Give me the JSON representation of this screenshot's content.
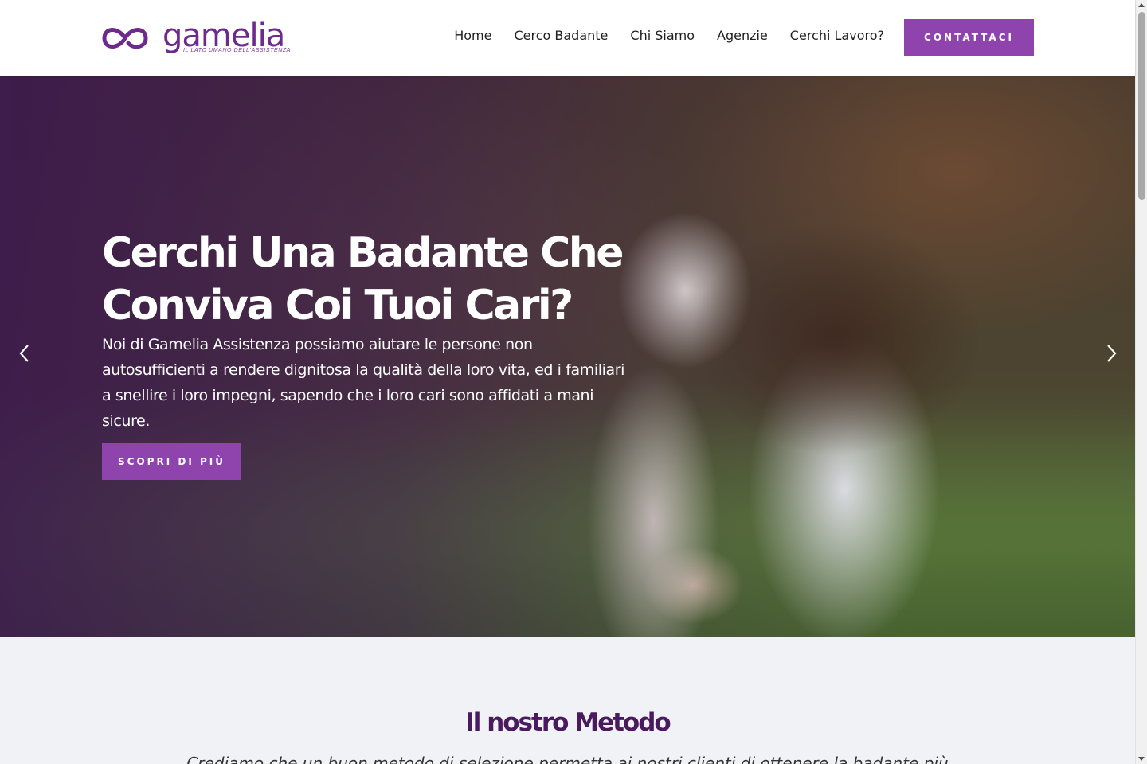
{
  "brand": {
    "name": "gamelia",
    "tagline": "IL LATO UMANO DELL'ASSISTENZA",
    "color": "#6d2a8c",
    "accent": "#8f44ad"
  },
  "nav": {
    "items": [
      {
        "label": "Home"
      },
      {
        "label": "Cerco Badante"
      },
      {
        "label": "Chi Siamo"
      },
      {
        "label": "Agenzie"
      },
      {
        "label": "Cerchi Lavoro?"
      }
    ],
    "cta_label": "CONTATTACI"
  },
  "hero": {
    "title": "Cerchi Una Badante Che Conviva Coi Tuoi Cari?",
    "text": "Noi di Gamelia Assistenza possiamo aiutare le persone non autosufficienti a rendere dignitosa la qualità della loro vita, ed i familiari a snellire i loro impegni, sapendo che i loro cari sono affidati a mani sicure.",
    "button_label": "SCOPRI DI PIÙ",
    "prev_icon": "chevron-left-icon",
    "next_icon": "chevron-right-icon"
  },
  "method": {
    "title": "Il nostro Metodo",
    "text": "Crediamo che un buon metodo di selezione permetta ai nostri clienti di ottenere la badante più"
  }
}
